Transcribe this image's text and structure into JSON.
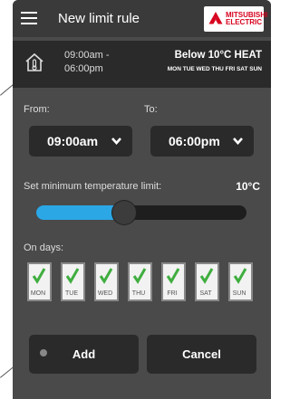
{
  "header": {
    "title": "New limit rule",
    "brand_line1": "MITSUBISHI",
    "brand_line2": "ELECTRIC"
  },
  "summary": {
    "time_range": "09:00am -\n06:00pm",
    "rule_title": "Below 10°C HEAT",
    "days": "MON TUE WED THU FRI SAT SUN"
  },
  "form": {
    "from_label": "From:",
    "to_label": "To:",
    "from_value": "09:00am",
    "to_value": "06:00pm",
    "temp_label": "Set minimum temperature limit:",
    "temp_value": "10°C",
    "slider_fraction": 0.42,
    "days_label": "On days:",
    "days": [
      {
        "label": "MON",
        "checked": true
      },
      {
        "label": "TUE",
        "checked": true
      },
      {
        "label": "WED",
        "checked": true
      },
      {
        "label": "THU",
        "checked": true
      },
      {
        "label": "FRI",
        "checked": true
      },
      {
        "label": "SAT",
        "checked": true
      },
      {
        "label": "SUN",
        "checked": true
      }
    ]
  },
  "actions": {
    "add": "Add",
    "cancel": "Cancel"
  },
  "colors": {
    "accent": "#2ba7e6",
    "check": "#3fae3f",
    "brand": "#d7001e"
  }
}
